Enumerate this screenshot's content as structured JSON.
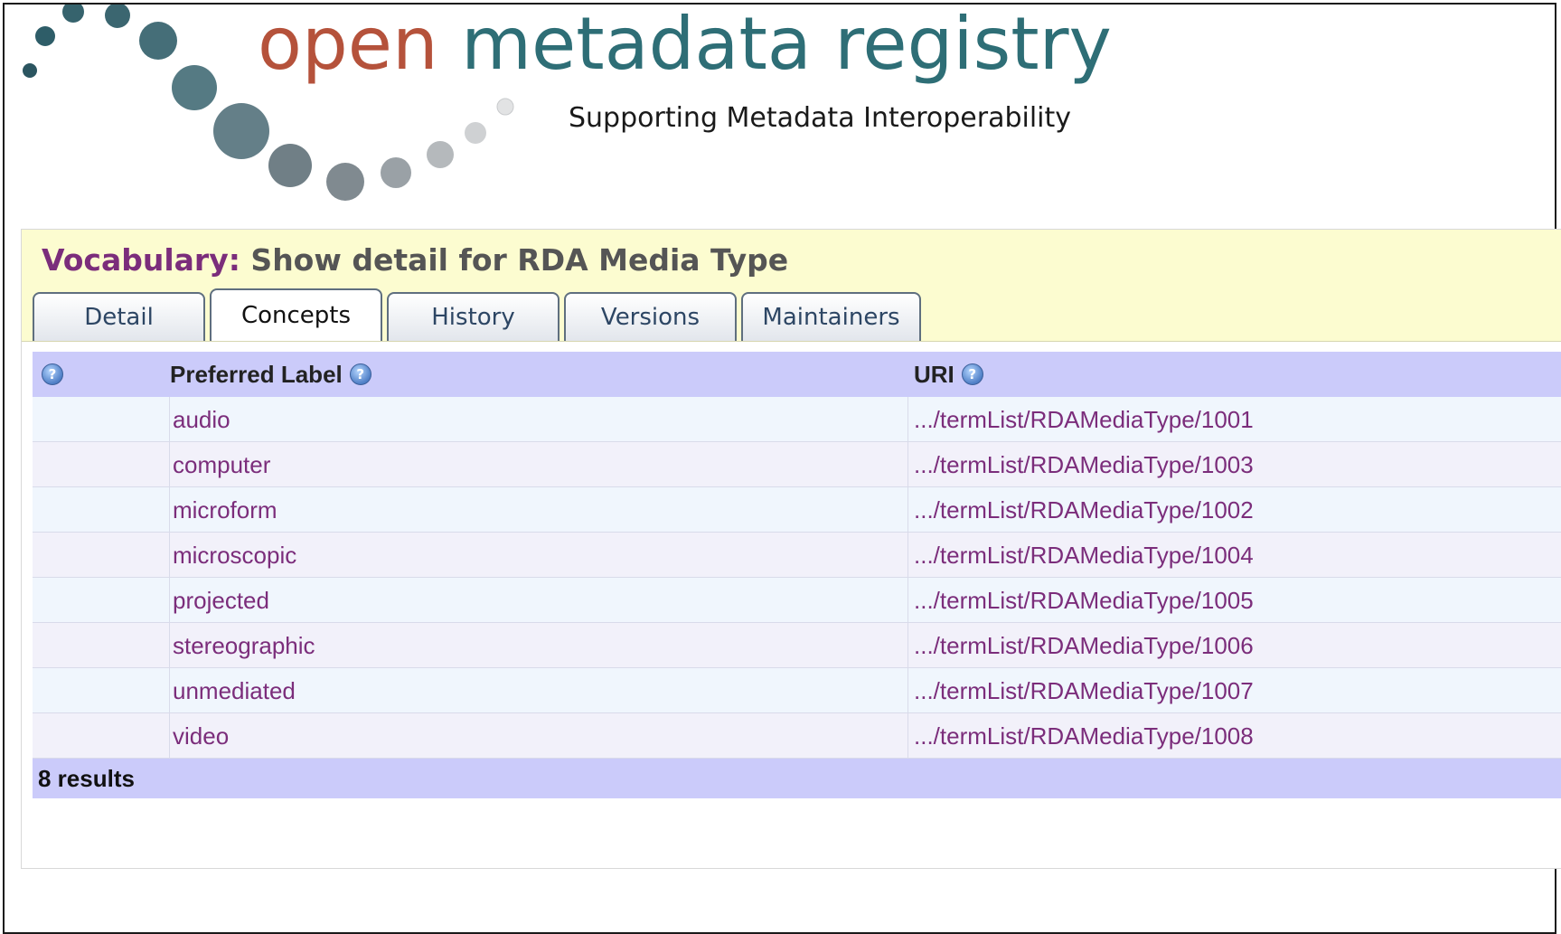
{
  "header": {
    "logo_word_1": "open",
    "logo_word_2": "metadata registry",
    "tagline": "Supporting Metadata Interoperability",
    "colors": {
      "logo_orange": "#b5523b",
      "logo_teal": "#2e6e76"
    }
  },
  "page": {
    "title_prefix": "Vocabulary:",
    "title_main": "Show detail for RDA Media Type"
  },
  "tabs": [
    {
      "label": "Detail",
      "active": false
    },
    {
      "label": "Concepts",
      "active": true
    },
    {
      "label": "History",
      "active": false
    },
    {
      "label": "Versions",
      "active": false
    },
    {
      "label": "Maintainers",
      "active": false
    }
  ],
  "table": {
    "columns": {
      "preferred_label": "Preferred Label",
      "uri": "URI"
    },
    "help_icon": "help-icon",
    "rows": [
      {
        "label": "audio",
        "uri": ".../termList/RDAMediaType/1001"
      },
      {
        "label": "computer",
        "uri": ".../termList/RDAMediaType/1003"
      },
      {
        "label": "microform",
        "uri": ".../termList/RDAMediaType/1002"
      },
      {
        "label": "microscopic",
        "uri": ".../termList/RDAMediaType/1004"
      },
      {
        "label": "projected",
        "uri": ".../termList/RDAMediaType/1005"
      },
      {
        "label": "stereographic",
        "uri": ".../termList/RDAMediaType/1006"
      },
      {
        "label": "unmediated",
        "uri": ".../termList/RDAMediaType/1007"
      },
      {
        "label": "video",
        "uri": ".../termList/RDAMediaType/1008"
      }
    ],
    "footer": "8 results"
  },
  "colors": {
    "title_bar_bg": "#fcfcd0",
    "table_header_bg": "#cbcbfa",
    "link_color": "#7b2d7b"
  }
}
